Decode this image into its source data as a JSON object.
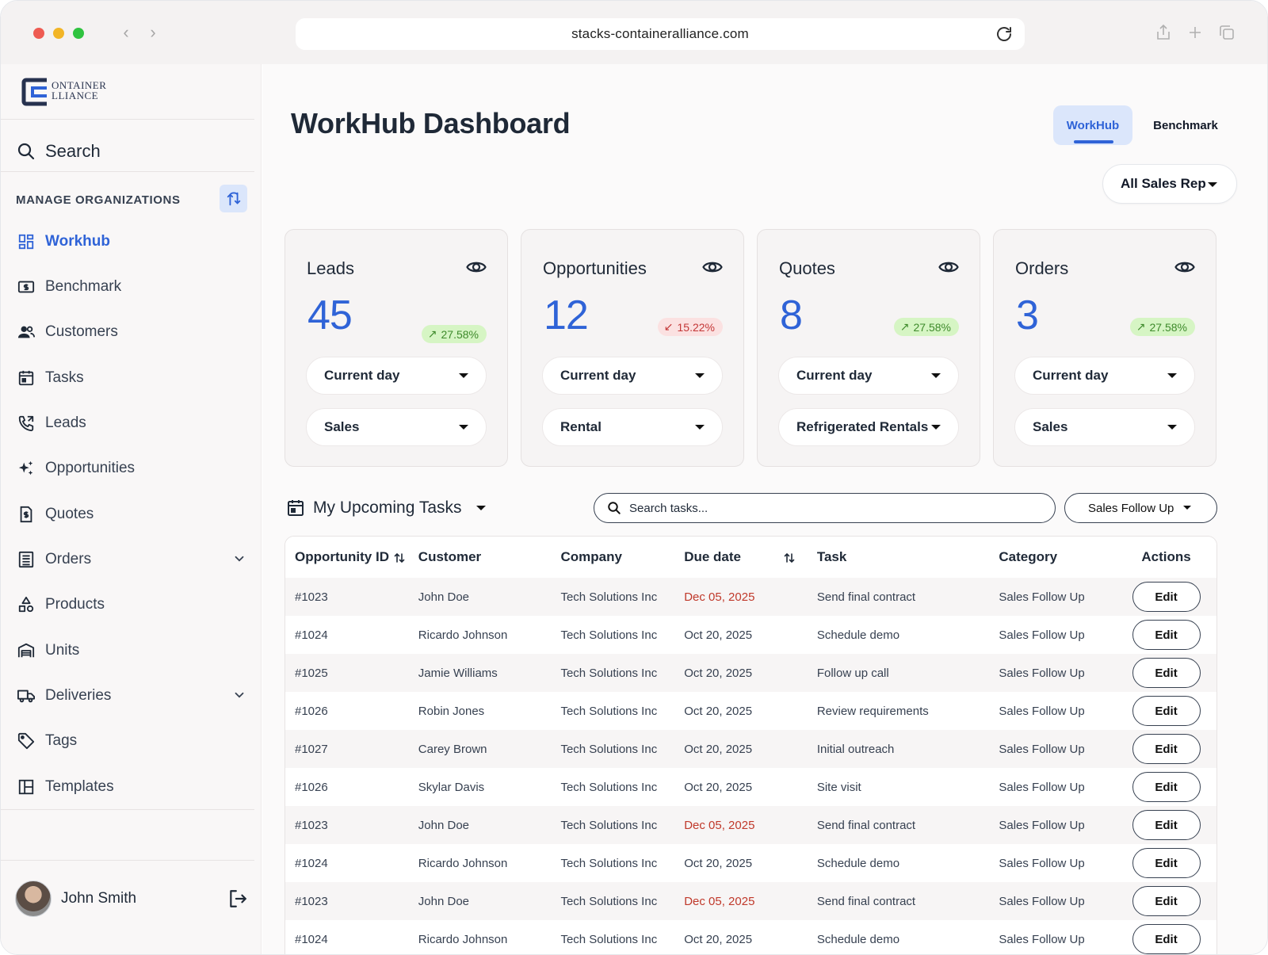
{
  "browser": {
    "url": "stacks-containeralliance.com"
  },
  "sidebar": {
    "logo_text_line1": "ONTAINER",
    "logo_text_line2": "LLIANCE",
    "search_label": "Search",
    "section_title": "MANAGE ORGANIZATIONS",
    "items": [
      {
        "label": "Workhub",
        "icon": "grid-icon",
        "active": true
      },
      {
        "label": "Benchmark",
        "icon": "dollar-bill-icon"
      },
      {
        "label": "Customers",
        "icon": "users-icon"
      },
      {
        "label": "Tasks",
        "icon": "calendar-icon"
      },
      {
        "label": "Leads",
        "icon": "phone-icon"
      },
      {
        "label": "Opportunities",
        "icon": "sparkles-icon"
      },
      {
        "label": "Quotes",
        "icon": "dollar-document-icon"
      },
      {
        "label": "Orders",
        "icon": "list-icon",
        "expandable": true
      },
      {
        "label": "Products",
        "icon": "shapes-icon"
      },
      {
        "label": "Units",
        "icon": "warehouse-icon"
      },
      {
        "label": "Deliveries",
        "icon": "truck-icon",
        "expandable": true
      },
      {
        "label": "Tags",
        "icon": "tag-icon"
      },
      {
        "label": "Templates",
        "icon": "layout-icon"
      }
    ],
    "user": {
      "name": "John Smith"
    }
  },
  "header": {
    "title": "WorkHub Dashboard",
    "tabs": [
      {
        "label": "WorkHub",
        "active": true
      },
      {
        "label": "Benchmark",
        "active": false
      }
    ],
    "rep_filter": "All Sales Rep"
  },
  "cards": [
    {
      "title": "Leads",
      "value": "45",
      "change": "27.58%",
      "trend": "up",
      "period": "Current day",
      "segment": "Sales"
    },
    {
      "title": "Opportunities",
      "value": "12",
      "change": "15.22%",
      "trend": "down",
      "period": "Current day",
      "segment": "Rental"
    },
    {
      "title": "Quotes",
      "value": "8",
      "change": "27.58%",
      "trend": "up",
      "period": "Current day",
      "segment": "Refrigerated Rentals"
    },
    {
      "title": "Orders",
      "value": "3",
      "change": "27.58%",
      "trend": "up",
      "period": "Current day",
      "segment": "Sales"
    }
  ],
  "tasks": {
    "title": "My Upcoming Tasks",
    "search_placeholder": "Search tasks...",
    "filter": "Sales Follow Up",
    "columns": [
      "Opportunity ID",
      "Customer",
      "Company",
      "Due date",
      "Task",
      "Category",
      "Actions"
    ],
    "edit_label": "Edit",
    "rows": [
      {
        "id": "#1023",
        "customer": "John Doe",
        "company": "Tech Solutions Inc",
        "due": "Dec 05, 2025",
        "overdue": true,
        "task": "Send final contract",
        "category": "Sales Follow Up"
      },
      {
        "id": "#1024",
        "customer": "Ricardo Johnson",
        "company": "Tech Solutions Inc",
        "due": "Oct 20, 2025",
        "overdue": false,
        "task": "Schedule demo",
        "category": "Sales Follow Up"
      },
      {
        "id": "#1025",
        "customer": "Jamie Williams",
        "company": "Tech Solutions Inc",
        "due": "Oct 20, 2025",
        "overdue": false,
        "task": "Follow up call",
        "category": "Sales Follow Up"
      },
      {
        "id": "#1026",
        "customer": "Robin Jones",
        "company": "Tech Solutions Inc",
        "due": "Oct 20, 2025",
        "overdue": false,
        "task": "Review requirements",
        "category": "Sales Follow Up"
      },
      {
        "id": "#1027",
        "customer": "Carey Brown",
        "company": "Tech Solutions Inc",
        "due": "Oct 20, 2025",
        "overdue": false,
        "task": "Initial outreach",
        "category": "Sales Follow Up"
      },
      {
        "id": "#1026",
        "customer": "Skylar Davis",
        "company": "Tech Solutions Inc",
        "due": "Oct 20, 2025",
        "overdue": false,
        "task": "Site visit",
        "category": "Sales Follow Up"
      },
      {
        "id": "#1023",
        "customer": "John Doe",
        "company": "Tech Solutions Inc",
        "due": "Dec 05, 2025",
        "overdue": true,
        "task": "Send final contract",
        "category": "Sales Follow Up"
      },
      {
        "id": "#1024",
        "customer": "Ricardo Johnson",
        "company": "Tech Solutions Inc",
        "due": "Oct 20, 2025",
        "overdue": false,
        "task": "Schedule demo",
        "category": "Sales Follow Up"
      },
      {
        "id": "#1023",
        "customer": "John Doe",
        "company": "Tech Solutions Inc",
        "due": "Dec 05, 2025",
        "overdue": true,
        "task": "Send final contract",
        "category": "Sales Follow Up"
      },
      {
        "id": "#1024",
        "customer": "Ricardo Johnson",
        "company": "Tech Solutions Inc",
        "due": "Oct 20, 2025",
        "overdue": false,
        "task": "Schedule demo",
        "category": "Sales Follow Up"
      }
    ]
  },
  "colors": {
    "accent": "#2f63d7",
    "accent_bg": "#dbe6fb",
    "up_bg": "#d6f5c4",
    "up_text": "#3e8a2b",
    "down_bg": "#fbe1e1",
    "down_text": "#c43737",
    "overdue": "#c0392b"
  }
}
